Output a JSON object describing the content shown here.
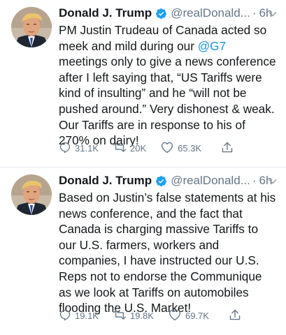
{
  "tweets": [
    {
      "author_name": "Donald J. Trump",
      "handle": "@realDonald...",
      "separator": "·",
      "time": "6h",
      "text_before": "PM Justin Trudeau of Canada acted so meek and mild during our ",
      "mention": "@G7",
      "text_after": "\nmeetings only to give a news conference after I left saying that, “US Tariffs were kind of insulting” and he “will not be pushed around.” Very dishonest & weak. Our Tariffs are in response to his of 270% on dairy!",
      "replies": "31.1K",
      "retweets": "20K",
      "likes": "65.3K"
    },
    {
      "author_name": "Donald J. Trump",
      "handle": "@realDonald...",
      "separator": "·",
      "time": "6h",
      "text_before": "Based on Justin’s false statements at his news conference, and the fact that Canada is charging massive Tariffs to our U.S. farmers, workers and companies, I have instructed our U.S. Reps not to endorse the Communique as we look at Tariffs on automobiles flooding the U.S. Market!",
      "mention": "",
      "text_after": "",
      "replies": "19.1K",
      "retweets": "19.8K",
      "likes": "69.7K"
    }
  ],
  "icons": {
    "verified": "verified-badge-icon",
    "caret": "chevron-down-icon",
    "reply": "reply-icon",
    "retweet": "retweet-icon",
    "like": "heart-icon",
    "share": "share-icon"
  },
  "colors": {
    "text": "#14171a",
    "secondary": "#657786",
    "link": "#1b95e0",
    "verified": "#1da1f2"
  }
}
